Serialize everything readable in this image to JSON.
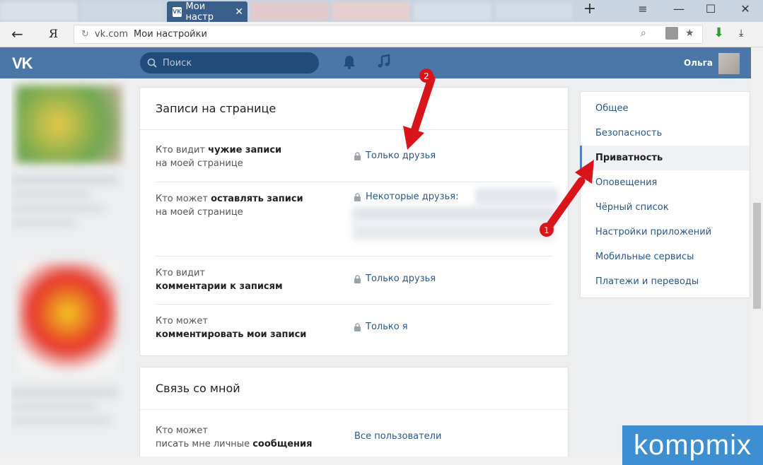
{
  "browser": {
    "active_tab_title": "Мои настр",
    "url_domain": "vk.com",
    "url_page_title": "Мои настройки",
    "nav_ya": "Я"
  },
  "vk": {
    "logo": "VK",
    "search_placeholder": "Поиск",
    "username": "Ольга"
  },
  "section_posts": {
    "title": "Записи на странице",
    "rows": [
      {
        "label_pre": "Кто видит ",
        "label_bold": "чужие записи",
        "label_post": "на моей странице",
        "value": "Только друзья"
      },
      {
        "label_pre": "Кто может ",
        "label_bold": "оставлять записи",
        "label_post": "на моей странице",
        "value": "Некоторые друзья:"
      },
      {
        "label_pre": "Кто видит",
        "label_bold": "комментарии к записям",
        "label_post": "",
        "value": "Только друзья"
      },
      {
        "label_pre": "Кто может",
        "label_bold": "комментировать мои записи",
        "label_post": "",
        "value": "Только я"
      }
    ]
  },
  "section_contact": {
    "title": "Связь со мной",
    "rows": [
      {
        "label_pre": "Кто может",
        "label_line2": "писать мне личные ",
        "label_bold": "сообщения",
        "value": "Все пользователи"
      }
    ]
  },
  "menu": {
    "items": [
      "Общее",
      "Безопасность",
      "Приватность",
      "Оповещения",
      "Чёрный список",
      "Настройки приложений",
      "Мобильные сервисы",
      "Платежи и переводы"
    ],
    "active": "Приватность"
  },
  "annotations": {
    "marker_1": "1",
    "marker_2": "2",
    "arrow_color": "#d9141a"
  },
  "watermark": "kompmix"
}
